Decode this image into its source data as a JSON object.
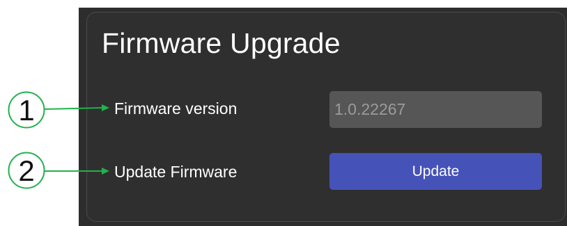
{
  "panel": {
    "title": "Firmware Upgrade"
  },
  "rows": {
    "version_label": "Firmware version",
    "version_value": "1.0.22267",
    "update_label": "Update Firmware",
    "update_button": "Update"
  },
  "callouts": [
    {
      "number": "1"
    },
    {
      "number": "2"
    }
  ],
  "colors": {
    "panel_bg": "#2f2f2f",
    "field_bg": "#565656",
    "button_bg": "#4553b8",
    "callout_green": "#22b14c"
  }
}
